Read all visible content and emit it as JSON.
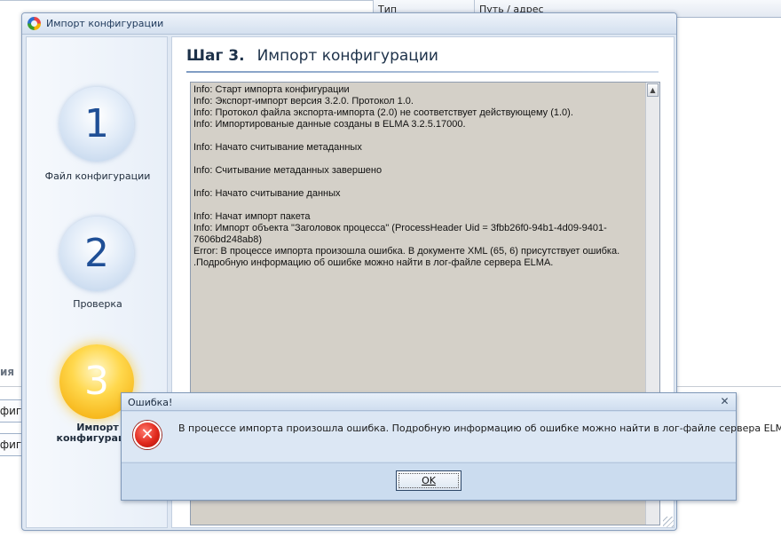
{
  "background": {
    "columns": [
      "Тип",
      "Путь / адрес"
    ],
    "section_label": "ия",
    "field_texts": [
      "нфигур",
      "нфигур"
    ]
  },
  "wizard": {
    "title": "Импорт конфигурации",
    "steps": [
      {
        "number": "1",
        "label": "Файл конфигурации",
        "active": false
      },
      {
        "number": "2",
        "label": "Проверка",
        "active": false
      },
      {
        "number": "3",
        "label_line1": "Импорт",
        "label_line2": "конфигурации",
        "active": true
      }
    ],
    "heading": {
      "step": "Шаг 3.",
      "title": "Импорт конфигурации"
    },
    "log_lines": [
      "Info: Старт импорта конфигурации",
      "Info: Экспорт-импорт версия 3.2.0. Протокол 1.0.",
      "Info: Протокол файла экспорта-импорта (2.0) не соответствует действующему (1.0).",
      "Info: Импортированые данные созданы в ELMA 3.2.5.17000.",
      "",
      "Info: Начато считывание метаданных",
      "",
      "Info: Считывание метаданных завершено",
      "",
      "Info: Начато считывание данных",
      "",
      "Info: Начат импорт пакета",
      "Info: Импорт объекта \"Заголовок процесса\" (ProcessHeader Uid = 3fbb26f0-94b1-4d09-9401-",
      "7606bd248ab8)",
      "Error: В процессе импорта произошла ошибка. В документе XML (65, 6) присутствует ошибка.",
      ".Подробную информацию об ошибке можно найти в лог-файле сервера ELMA."
    ]
  },
  "dialog": {
    "title": "Ошибка!",
    "message": "В процессе импорта произошла ошибка. Подробную информацию об ошибке можно найти в лог-файле сервера ELMA.",
    "ok_label": "OK",
    "icon": "error-icon"
  },
  "colors": {
    "active_step": "#ffd84d",
    "inactive_step": "#bcd1ea",
    "log_background": "#d4d0c8",
    "error_red": "#e0281c"
  }
}
